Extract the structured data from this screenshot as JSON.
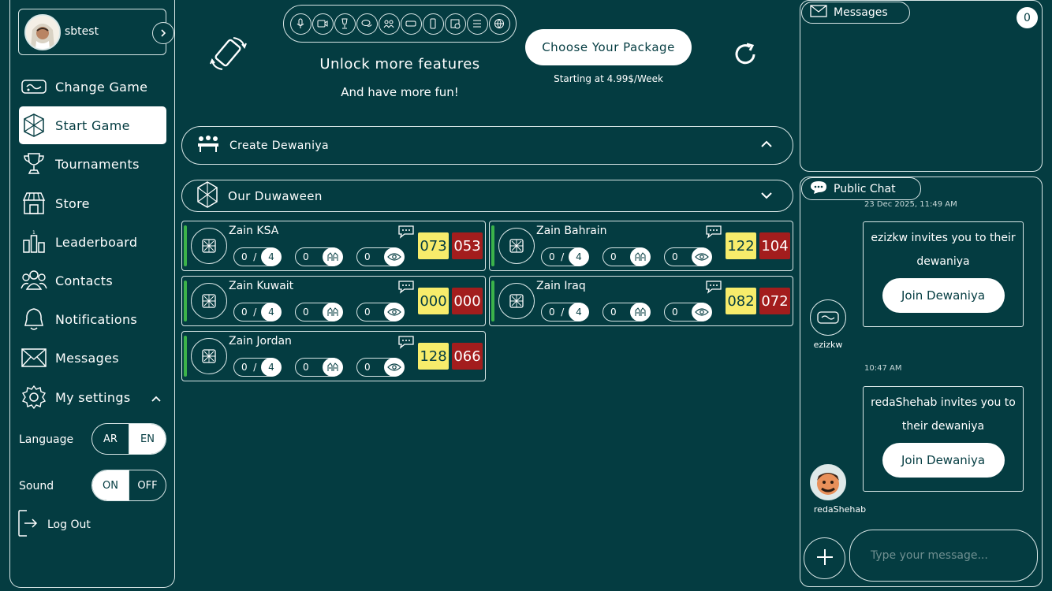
{
  "user": {
    "name": "sbtest"
  },
  "nav": {
    "change_game": "Change Game",
    "start_game": "Start Game",
    "tournaments": "Tournaments",
    "store": "Store",
    "leaderboard": "Leaderboard",
    "contacts": "Contacts",
    "notifications": "Notifications",
    "messages": "Messages",
    "my_settings": "My settings",
    "log_out": "Log Out"
  },
  "settings": {
    "language_label": "Language",
    "lang_ar": "AR",
    "lang_en": "EN",
    "sound_label": "Sound",
    "sound_on": "ON",
    "sound_off": "OFF"
  },
  "banner": {
    "title": "Unlock more features",
    "subtitle": "And have more fun!",
    "cta": "Choose Your Package",
    "price_note": "Starting at 4.99$/Week"
  },
  "sections": {
    "create": "Create Dewaniya",
    "ours": "Our Duwaween"
  },
  "rooms": [
    {
      "name": "Zain KSA",
      "players": "0",
      "max": "4",
      "rounds": "0",
      "viewers": "0",
      "score_a": "073",
      "score_b": "053"
    },
    {
      "name": "Zain Bahrain",
      "players": "0",
      "max": "4",
      "rounds": "0",
      "viewers": "0",
      "score_a": "122",
      "score_b": "104"
    },
    {
      "name": "Zain Kuwait",
      "players": "0",
      "max": "4",
      "rounds": "0",
      "viewers": "0",
      "score_a": "000",
      "score_b": "000"
    },
    {
      "name": "Zain Iraq",
      "players": "0",
      "max": "4",
      "rounds": "0",
      "viewers": "0",
      "score_a": "082",
      "score_b": "072"
    },
    {
      "name": "Zain Jordan",
      "players": "0",
      "max": "4",
      "rounds": "0",
      "viewers": "0",
      "score_a": "128",
      "score_b": "066"
    }
  ],
  "messages_panel": {
    "title": "Messages",
    "count": "0"
  },
  "chat": {
    "title": "Public Chat",
    "top_timestamp": "23 Dec 2025, 11:49 AM",
    "entries": [
      {
        "user": "ezizkw",
        "text": "ezizkw invites you to their dewaniya",
        "button": "Join Dewaniya"
      },
      {
        "user": "redaShehab",
        "timestamp": "10:47 AM",
        "text": "redaShehab invites you to their dewaniya",
        "button": "Join Dewaniya"
      }
    ],
    "input_placeholder": "Type your message..."
  },
  "colors": {
    "background": "#043c41",
    "score_yellow": "#f7ec6b",
    "score_red": "#a31d1d",
    "accent_green": "#3bb34a"
  },
  "icons": [
    "rotate-device-icon",
    "refresh-icon",
    "cards-icon",
    "trophy-icon",
    "store-icon",
    "leaderboard-icon",
    "contacts-icon",
    "bell-icon",
    "envelope-icon",
    "gear-icon",
    "logout-icon",
    "chat-bubble-icon",
    "eye-icon",
    "plus-icon"
  ]
}
